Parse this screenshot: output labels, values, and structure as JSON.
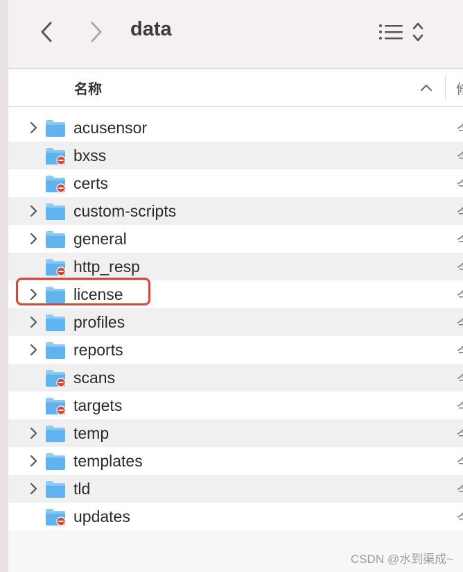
{
  "window": {
    "title": "data"
  },
  "toolbar": {
    "back_icon": "chevron-left-icon",
    "forward_icon": "chevron-right-icon",
    "view_icon": "list-view-icon",
    "sort_icon": "up-down-chevron-icon"
  },
  "columns": {
    "name_label": "名称",
    "next_label": "修",
    "sort_direction": "ascending"
  },
  "rows": [
    {
      "name": "acusensor",
      "expandable": true,
      "restricted": false,
      "extra": "今"
    },
    {
      "name": "bxss",
      "expandable": false,
      "restricted": true,
      "extra": "今"
    },
    {
      "name": "certs",
      "expandable": false,
      "restricted": true,
      "extra": "今"
    },
    {
      "name": "custom-scripts",
      "expandable": true,
      "restricted": false,
      "extra": "今"
    },
    {
      "name": "general",
      "expandable": true,
      "restricted": false,
      "extra": "今"
    },
    {
      "name": "http_resp",
      "expandable": false,
      "restricted": true,
      "extra": "今"
    },
    {
      "name": "license",
      "expandable": true,
      "restricted": false,
      "extra": "今",
      "highlighted": true
    },
    {
      "name": "profiles",
      "expandable": true,
      "restricted": false,
      "extra": "今"
    },
    {
      "name": "reports",
      "expandable": true,
      "restricted": false,
      "extra": "今"
    },
    {
      "name": "scans",
      "expandable": false,
      "restricted": true,
      "extra": "今"
    },
    {
      "name": "targets",
      "expandable": false,
      "restricted": true,
      "extra": "今"
    },
    {
      "name": "temp",
      "expandable": true,
      "restricted": false,
      "extra": "今"
    },
    {
      "name": "templates",
      "expandable": true,
      "restricted": false,
      "extra": "今"
    },
    {
      "name": "tld",
      "expandable": true,
      "restricted": false,
      "extra": "今"
    },
    {
      "name": "updates",
      "expandable": false,
      "restricted": true,
      "extra": "今"
    }
  ],
  "colors": {
    "folder_blue": "#5fb4ef",
    "folder_tab": "#8ccdf7",
    "restricted_badge": "#e0442f",
    "highlight_border": "#e0442f"
  },
  "watermark": "CSDN @水到渠成~"
}
